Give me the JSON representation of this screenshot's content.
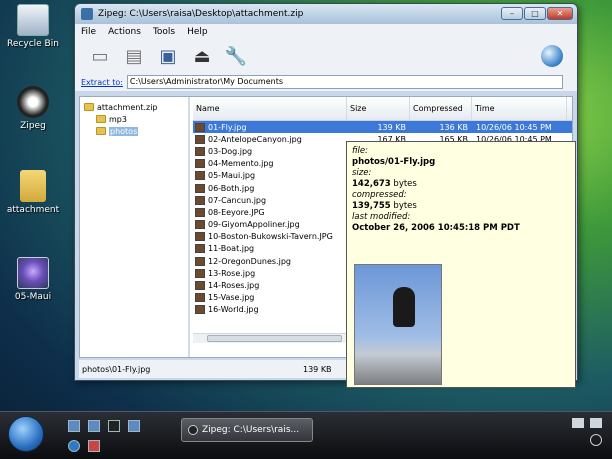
{
  "desktop": {
    "icons": [
      {
        "label": "Recycle Bin"
      },
      {
        "label": "Zipeg"
      },
      {
        "label": "attachment"
      },
      {
        "label": "05-Maui"
      }
    ]
  },
  "window": {
    "title": "Zipeg: C:\\Users\\raisa\\Desktop\\attachment.zip",
    "buttons": {
      "minimize": "–",
      "maximize": "□",
      "close": "✕"
    },
    "menu": [
      "File",
      "Actions",
      "Tools",
      "Help"
    ],
    "extract": {
      "label": "Extract to:",
      "value": "C:\\Users\\Administrator\\My Documents"
    },
    "tree": [
      {
        "label": "attachment.zip"
      },
      {
        "label": "mp3"
      },
      {
        "label": "photos"
      }
    ],
    "columns": [
      "Name",
      "Size",
      "Compressed",
      "Time"
    ],
    "files": [
      {
        "name": "01-Fly.jpg",
        "size": "139 KB",
        "compressed": "136 KB",
        "time": "10/26/06 10:45 PM"
      },
      {
        "name": "02-AntelopeCanyon.jpg",
        "size": "167 KB",
        "compressed": "165 KB",
        "time": "10/26/06 10:45 PM"
      },
      {
        "name": "03-Dog.jpg",
        "size": "",
        "compressed": "",
        "time": ""
      },
      {
        "name": "04-Memento.jpg",
        "size": "",
        "compressed": "",
        "time": ""
      },
      {
        "name": "05-Maui.jpg",
        "size": "",
        "compressed": "",
        "time": ""
      },
      {
        "name": "06-Both.jpg",
        "size": "",
        "compressed": "",
        "time": ""
      },
      {
        "name": "07-Cancun.jpg",
        "size": "",
        "compressed": "",
        "time": ""
      },
      {
        "name": "08-Eeyore.JPG",
        "size": "",
        "compressed": "",
        "time": ""
      },
      {
        "name": "09-GiyomAppoliner.jpg",
        "size": "",
        "compressed": "",
        "time": ""
      },
      {
        "name": "10-Boston-Bukowski-Tavern.JPG",
        "size": "",
        "compressed": "",
        "time": ""
      },
      {
        "name": "11-Boat.jpg",
        "size": "",
        "compressed": "",
        "time": ""
      },
      {
        "name": "12-OregonDunes.jpg",
        "size": "",
        "compressed": "",
        "time": ""
      },
      {
        "name": "13-Rose.jpg",
        "size": "",
        "compressed": "",
        "time": ""
      },
      {
        "name": "14-Roses.jpg",
        "size": "",
        "compressed": "",
        "time": ""
      },
      {
        "name": "15-Vase.jpg",
        "size": "",
        "compressed": "",
        "time": ""
      },
      {
        "name": "16-World.jpg",
        "size": "",
        "compressed": "",
        "time": ""
      }
    ],
    "status": {
      "path": "photos\\01-Fly.jpg",
      "size": "139 KB"
    }
  },
  "tooltip": {
    "file_label": "file:",
    "file_value": "photos/01-Fly.jpg",
    "size_label": "size:",
    "size_value": "142,673",
    "size_unit": " bytes",
    "compressed_label": "compressed:",
    "compressed_value": "139,755",
    "compressed_unit": " bytes",
    "modified_label": "last modified:",
    "modified_value": "October 26, 2006 10:45:18 PM PDT"
  },
  "taskbar": {
    "task_label": "Zipeg: C:\\Users\\rais..."
  },
  "colors": {
    "selection": "#3b78d8",
    "tooltip_bg": "#ffffe1",
    "link": "#0033cc"
  }
}
